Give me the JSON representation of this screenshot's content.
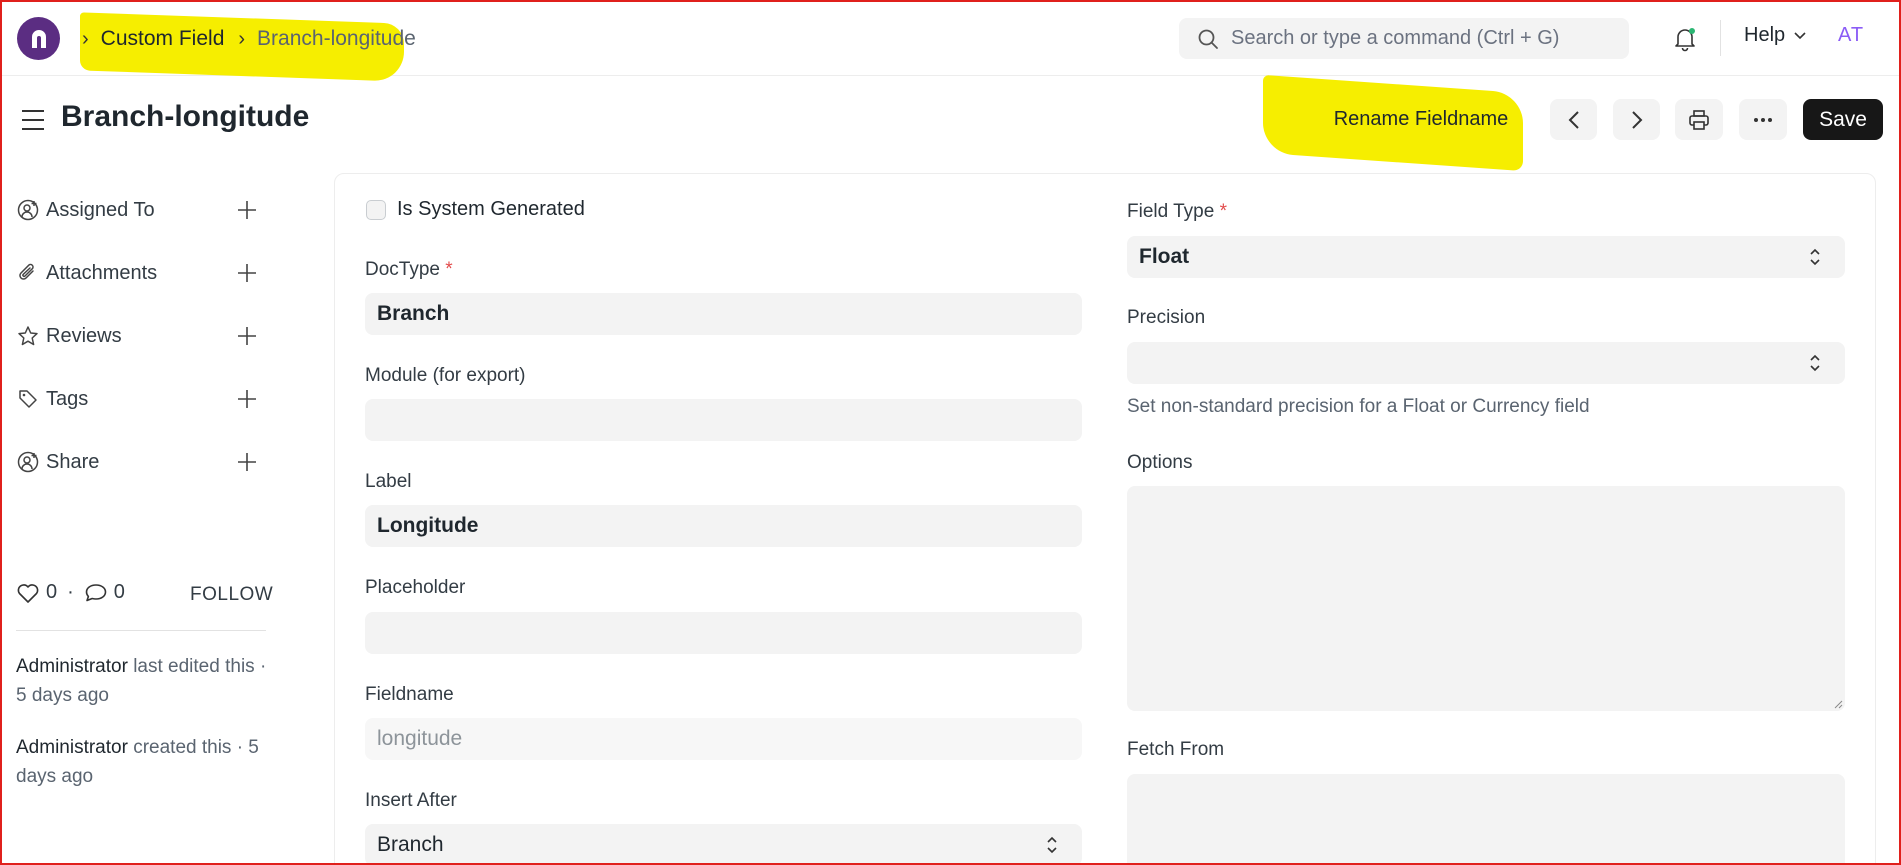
{
  "navbar": {
    "breadcrumbs": [
      "Custom Field",
      "Branch-longitude"
    ],
    "search_placeholder": "Search or type a command (Ctrl + G)",
    "help_label": "Help",
    "avatar_initials": "AT",
    "brand_color": "#5b2d82",
    "highlight_color": "#f6ee00"
  },
  "header": {
    "title": "Branch-longitude",
    "rename_label": "Rename Fieldname",
    "save_label": "Save"
  },
  "sidebar": {
    "items": [
      {
        "label": "Assigned To",
        "icon": "user-plus-icon"
      },
      {
        "label": "Attachments",
        "icon": "paperclip-icon"
      },
      {
        "label": "Reviews",
        "icon": "star-icon"
      },
      {
        "label": "Tags",
        "icon": "tag-icon"
      },
      {
        "label": "Share",
        "icon": "user-share-icon"
      }
    ],
    "likes": "0",
    "comments": "0",
    "follow_label": "FOLLOW",
    "activity": [
      {
        "user": "Administrator",
        "text": " last edited this · 5 days ago"
      },
      {
        "user": "Administrator",
        "text": " created this · 5 days ago"
      }
    ]
  },
  "form": {
    "is_system_generated_label": "Is System Generated",
    "doctype_label": "DocType",
    "doctype_value": "Branch",
    "module_label": "Module (for export)",
    "module_value": "",
    "label_label": "Label",
    "label_value": "Longitude",
    "placeholder_label": "Placeholder",
    "placeholder_value": "",
    "fieldname_label": "Fieldname",
    "fieldname_value": "longitude",
    "insert_after_label": "Insert After",
    "insert_after_value": "Branch",
    "field_type_label": "Field Type",
    "field_type_value": "Float",
    "precision_label": "Precision",
    "precision_value": "",
    "precision_hint": "Set non-standard precision for a Float or Currency field",
    "options_label": "Options",
    "fetch_from_label": "Fetch From",
    "required_marker": "*"
  }
}
